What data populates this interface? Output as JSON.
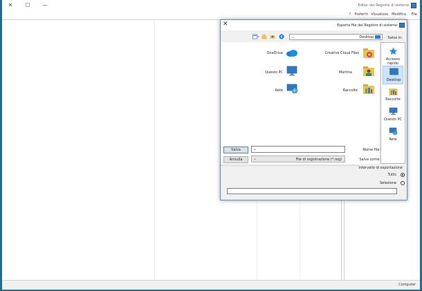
{
  "window": {
    "title": "Editor del Registro di sistema",
    "minimize_glyph": "—",
    "maximize_glyph": "☐",
    "close_glyph": "✕"
  },
  "menu": [
    "File",
    "Modifica",
    "Visualizza",
    "Preferiti",
    "?"
  ],
  "statusbar": {
    "text": "Computer"
  },
  "dialog": {
    "title": "Esporta file del Registro di sistema",
    "close_glyph": "✕",
    "save_in_label": "Salva in:",
    "location": "Desktop",
    "places": [
      {
        "label": "Accesso rapido",
        "icon": "star-icon"
      },
      {
        "label": "Desktop",
        "icon": "desktop-icon"
      },
      {
        "label": "Raccolte",
        "icon": "libraries-icon"
      },
      {
        "label": "Questo PC",
        "icon": "computer-icon"
      },
      {
        "label": "Rete",
        "icon": "network-icon"
      }
    ],
    "files": [
      {
        "label": "Creative Cloud Files",
        "icon": "cloud-files-icon"
      },
      {
        "label": "OneDrive",
        "icon": "onedrive-icon"
      },
      {
        "label": "Martina",
        "icon": "user-folder-icon"
      },
      {
        "label": "Questo PC",
        "icon": "computer-icon"
      },
      {
        "label": "Raccolte",
        "icon": "libraries-icon"
      },
      {
        "label": "Rete",
        "icon": "network-icon"
      }
    ],
    "filename_label": "Nome file:",
    "filename_value": "",
    "savetype_label": "Salva come:",
    "savetype_value": "File di registrazione (*.reg)",
    "save_button": "Salva",
    "cancel_button": "Annulla",
    "range_label": "Intervallo di esportazione",
    "range_all": "Tutto",
    "range_selected": "Selezione",
    "branch_value": ""
  },
  "colors": {
    "accent": "#1f6b92",
    "selection": "#cce4f7",
    "folder": "#e8c25a"
  }
}
